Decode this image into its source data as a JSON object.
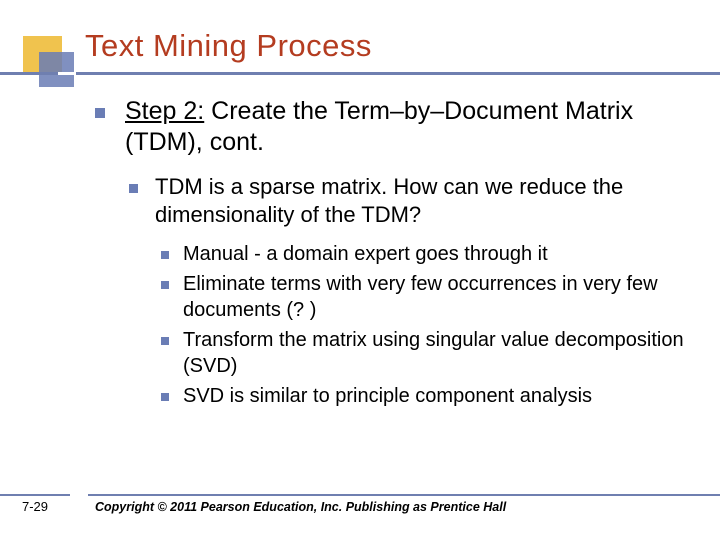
{
  "title": "Text Mining Process",
  "step_label": "Step 2:",
  "step_text_rest": " Create the Term–by–Document Matrix (TDM), cont.",
  "sub1": "TDM is a sparse matrix. How can we reduce the dimensionality of the TDM?",
  "points": [
    "Manual - a domain expert goes through it",
    "Eliminate terms with very few occurrences in very few documents (? )",
    "Transform the matrix using singular value decomposition (SVD)",
    "SVD is similar to principle component analysis"
  ],
  "slide_number": "7-29",
  "copyright": "Copyright © 2011 Pearson Education, Inc. Publishing as Prentice Hall"
}
